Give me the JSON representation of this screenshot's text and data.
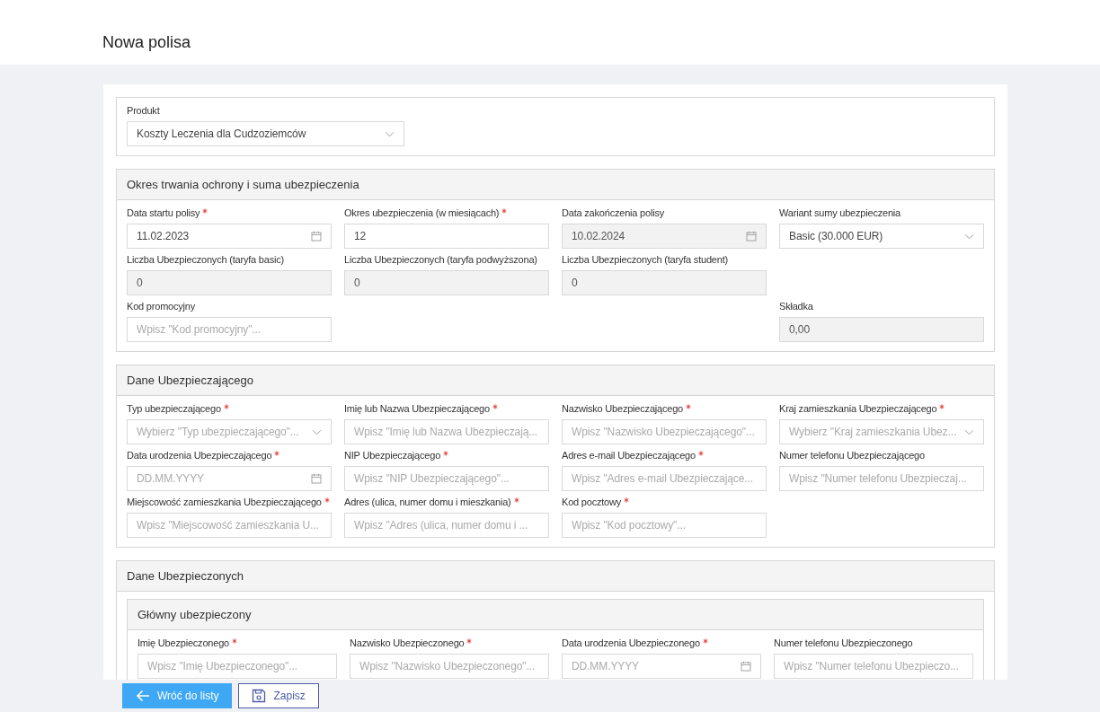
{
  "page": {
    "title": "Nowa polisa"
  },
  "sections": [
    {
      "kind": "plain",
      "rows": [
        [
          {
            "kind": "select",
            "label": "Produkt",
            "required": false,
            "disabled": false,
            "value": "Koszty Leczenia dla Cudzoziemców"
          }
        ]
      ]
    },
    {
      "kind": "panel",
      "title": "Okres trwania ochrony i suma ubezpieczenia",
      "rows": [
        [
          {
            "kind": "date",
            "label": "Data startu polisy",
            "required": true,
            "disabled": false,
            "value": "11.02.2023"
          },
          {
            "kind": "input",
            "label": "Okres ubezpieczenia (w miesiącach)",
            "required": true,
            "disabled": false,
            "value": "12"
          },
          {
            "kind": "date",
            "label": "Data zakończenia polisy",
            "required": false,
            "disabled": true,
            "value": "10.02.2024"
          },
          {
            "kind": "select",
            "label": "Wariant sumy ubezpieczenia",
            "required": false,
            "disabled": false,
            "value": "Basic (30.000 EUR)"
          }
        ],
        [
          {
            "kind": "input",
            "label": "Liczba Ubezpieczonych (taryfa basic)",
            "required": false,
            "disabled": true,
            "value": "0"
          },
          {
            "kind": "input",
            "label": "Liczba Ubezpieczonych (taryfa podwyższona)",
            "required": false,
            "disabled": true,
            "value": "0"
          },
          {
            "kind": "input",
            "label": "Liczba Ubezpieczonych (taryfa student)",
            "required": false,
            "disabled": true,
            "value": "0"
          },
          {
            "kind": "spacer"
          }
        ],
        [
          {
            "kind": "input",
            "label": "Kod promocyjny",
            "required": false,
            "disabled": false,
            "placeholder": "Wpisz \"Kod promocyjny\"..."
          },
          {
            "kind": "spacer"
          },
          {
            "kind": "spacer"
          },
          {
            "kind": "input",
            "label": "Składka",
            "required": false,
            "disabled": true,
            "value": "0,00"
          }
        ]
      ]
    },
    {
      "kind": "panel",
      "title": "Dane Ubezpieczającego",
      "rows": [
        [
          {
            "kind": "select",
            "label": "Typ ubezpieczającego",
            "required": true,
            "disabled": false,
            "placeholder": "Wybierz \"Typ ubezpieczającego\"..."
          },
          {
            "kind": "input",
            "label": "Imię lub Nazwa Ubezpieczającego",
            "required": true,
            "disabled": false,
            "placeholder": "Wpisz \"Imię lub Nazwa Ubezpieczają..."
          },
          {
            "kind": "input",
            "label": "Nazwisko Ubezpieczającego",
            "required": true,
            "disabled": false,
            "placeholder": "Wpisz \"Nazwisko Ubezpieczającego\"..."
          },
          {
            "kind": "select",
            "label": "Kraj zamieszkania Ubezpieczającego",
            "required": true,
            "disabled": false,
            "placeholder": "Wybierz \"Kraj zamieszkania Ubez..."
          }
        ],
        [
          {
            "kind": "date",
            "label": "Data urodzenia Ubezpieczającego",
            "required": true,
            "disabled": false,
            "placeholder": "DD.MM.YYYY"
          },
          {
            "kind": "input",
            "label": "NIP Ubezpieczającego",
            "required": true,
            "disabled": false,
            "placeholder": "Wpisz \"NIP Ubezpieczającego\"..."
          },
          {
            "kind": "input",
            "label": "Adres e-mail Ubezpieczającego",
            "required": true,
            "disabled": false,
            "placeholder": "Wpisz \"Adres e-mail Ubezpieczające..."
          },
          {
            "kind": "input",
            "label": "Numer telefonu Ubezpieczającego",
            "required": false,
            "disabled": false,
            "placeholder": "Wpisz \"Numer telefonu Ubezpieczaj..."
          }
        ],
        [
          {
            "kind": "input",
            "label": "Miejscowość zamieszkania Ubezpieczającego",
            "required": true,
            "disabled": false,
            "placeholder": "Wpisz \"Miejscowość zamieszkania U..."
          },
          {
            "kind": "input",
            "label": "Adres (ulica, numer domu i mieszkania)",
            "required": true,
            "disabled": false,
            "placeholder": "Wpisz \"Adres (ulica, numer domu i ..."
          },
          {
            "kind": "input",
            "label": "Kod pocztowy",
            "required": true,
            "disabled": false,
            "placeholder": "Wpisz \"Kod pocztowy\"..."
          },
          {
            "kind": "spacer"
          }
        ]
      ]
    },
    {
      "kind": "panel",
      "title": "Dane Ubezpieczonych",
      "subsections": [
        {
          "title": "Główny ubezpieczony",
          "rows": [
            [
              {
                "kind": "input",
                "label": "Imię Ubezpieczonego",
                "required": true,
                "disabled": false,
                "placeholder": "Wpisz \"Imię Ubezpieczonego\"..."
              },
              {
                "kind": "input",
                "label": "Nazwisko Ubezpieczonego",
                "required": true,
                "disabled": false,
                "placeholder": "Wpisz \"Nazwisko Ubezpieczonego\"..."
              },
              {
                "kind": "date",
                "label": "Data urodzenia Ubezpieczonego",
                "required": true,
                "disabled": false,
                "placeholder": "DD.MM.YYYY"
              },
              {
                "kind": "input",
                "label": "Numer telefonu Ubezpieczonego",
                "required": false,
                "disabled": false,
                "placeholder": "Wpisz \"Numer telefonu Ubezpieczo..."
              }
            ]
          ]
        }
      ]
    }
  ],
  "footer": {
    "buttons": [
      {
        "kind": "back",
        "label": "Wróć do listy"
      },
      {
        "kind": "save",
        "label": "Zapisz"
      }
    ]
  }
}
